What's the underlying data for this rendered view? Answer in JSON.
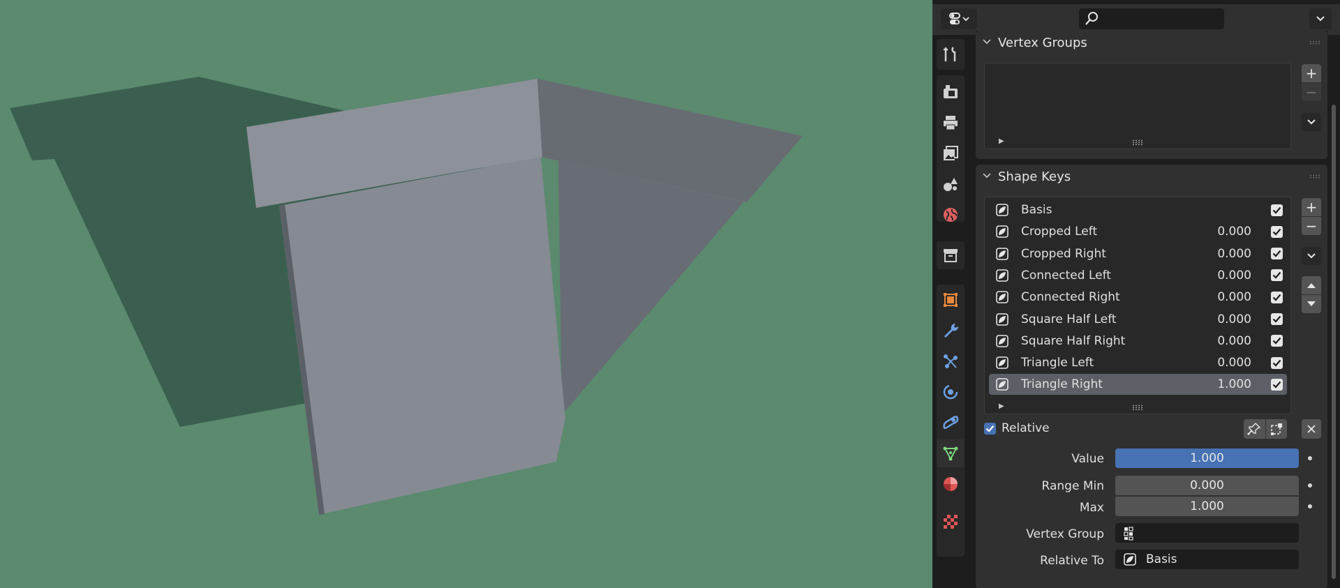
{
  "header": {
    "editor_type_icon": "properties-editor-icon",
    "search_placeholder": "",
    "options_icon": "chevron-down-icon"
  },
  "tabs": [
    {
      "name": "tool",
      "icon": "tool-icon"
    },
    {
      "name": "render",
      "icon": "render-icon"
    },
    {
      "name": "output",
      "icon": "printer-icon"
    },
    {
      "name": "view-layer",
      "icon": "image-stack-icon"
    },
    {
      "name": "scene",
      "icon": "scene-icon"
    },
    {
      "name": "world",
      "icon": "world-icon"
    },
    {
      "name": "collection",
      "icon": "collection-box-icon"
    },
    {
      "name": "object",
      "icon": "object-icon"
    },
    {
      "name": "modifiers",
      "icon": "wrench-icon"
    },
    {
      "name": "particles",
      "icon": "particles-icon"
    },
    {
      "name": "physics",
      "icon": "physics-icon"
    },
    {
      "name": "constraints",
      "icon": "constraint-icon"
    },
    {
      "name": "data",
      "icon": "mesh-data-icon"
    },
    {
      "name": "material",
      "icon": "material-icon"
    },
    {
      "name": "texture",
      "icon": "checker-icon"
    }
  ],
  "vertex_groups": {
    "title": "Vertex Groups"
  },
  "shape_keys": {
    "title": "Shape Keys",
    "items": [
      {
        "name": "Basis",
        "value": "",
        "checked": true
      },
      {
        "name": "Cropped Left",
        "value": "0.000",
        "checked": true
      },
      {
        "name": "Cropped Right",
        "value": "0.000",
        "checked": true
      },
      {
        "name": "Connected Left",
        "value": "0.000",
        "checked": true
      },
      {
        "name": "Connected Right",
        "value": "0.000",
        "checked": true
      },
      {
        "name": "Square Half Left",
        "value": "0.000",
        "checked": true
      },
      {
        "name": "Square Half Right",
        "value": "0.000",
        "checked": true
      },
      {
        "name": "Triangle Left",
        "value": "0.000",
        "checked": true
      },
      {
        "name": "Triangle Right",
        "value": "1.000",
        "checked": true,
        "selected": true
      }
    ],
    "relative_label": "Relative",
    "value_label": "Value",
    "value": "1.000",
    "range_min_label": "Range Min",
    "range_min": "0.000",
    "max_label": "Max",
    "max": "1.000",
    "vertex_group_label": "Vertex Group",
    "vertex_group_value": "",
    "relative_to_label": "Relative To",
    "relative_to_value": "Basis"
  },
  "colors": {
    "viewport_bg": "#5b8a6f",
    "accent_blue": "#4772b3",
    "panel_bg": "#303030"
  }
}
